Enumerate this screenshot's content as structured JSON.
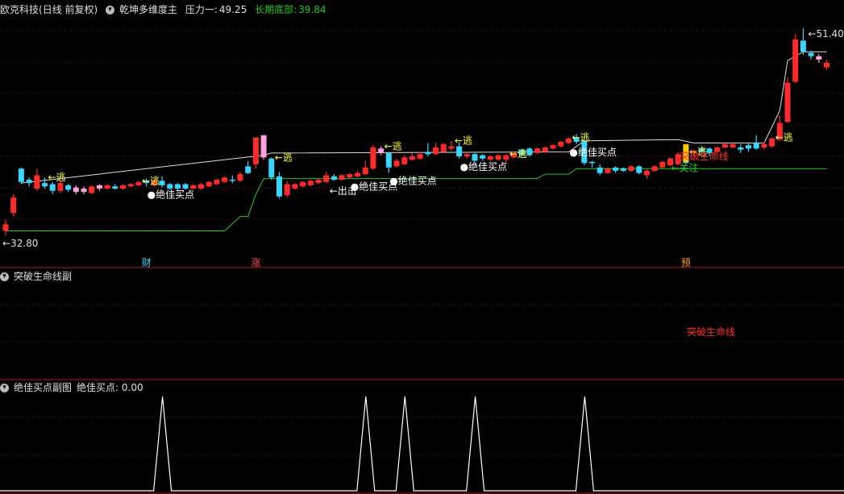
{
  "main": {
    "stock": "欧克科技",
    "period": "(日线 前复权)",
    "indicator": "乾坤多维度主",
    "pressure_label": "压力一:",
    "pressure_value": "49.25",
    "bottom_label": "长期底部:",
    "bottom_value": "39.84",
    "high_label": "51.40",
    "low_label": "32.80",
    "colors": {
      "up": "#ff2a2a",
      "down": "#38d5ff",
      "special": "#ffa0e0",
      "pressure": "#dddddd",
      "bottom": "#22cc22"
    }
  },
  "sub1": {
    "title": "突破生命线副",
    "label": "突破生命线"
  },
  "sub2": {
    "title": "绝佳买点副图",
    "value_label": "绝佳买点: 0.00"
  },
  "chart_data": {
    "type": "candlestick",
    "x_range": [
      0,
      105
    ],
    "y_range": [
      31.5,
      52.5
    ],
    "candles": [
      [
        0,
        33.2,
        33.8,
        32.8,
        34.2,
        "up"
      ],
      [
        1,
        34.8,
        36.2,
        34.5,
        36.5,
        "up"
      ],
      [
        2,
        38.8,
        37.6,
        37.4,
        38.9,
        "down"
      ],
      [
        3,
        37.8,
        37.5,
        37.2,
        38.0,
        "down"
      ],
      [
        4,
        37.0,
        38.2,
        36.8,
        38.8,
        "up"
      ],
      [
        5,
        37.5,
        37.2,
        37.0,
        38.0,
        "down"
      ],
      [
        6,
        37.4,
        36.8,
        36.5,
        37.6,
        "down"
      ],
      [
        7,
        36.8,
        37.5,
        36.6,
        37.7,
        "up"
      ],
      [
        8,
        37.3,
        36.9,
        36.7,
        37.4,
        "down"
      ],
      [
        9,
        37.1,
        36.7,
        36.5,
        37.3,
        "special"
      ],
      [
        10,
        37.0,
        36.7,
        36.5,
        37.2,
        "special"
      ],
      [
        11,
        36.6,
        37.2,
        36.5,
        37.3,
        "up"
      ],
      [
        12,
        37.0,
        37.3,
        36.8,
        37.4,
        "special"
      ],
      [
        13,
        37.0,
        37.3,
        36.9,
        37.4,
        "up"
      ],
      [
        14,
        37.2,
        37.0,
        36.9,
        37.4,
        "down"
      ],
      [
        15,
        37.0,
        37.3,
        36.9,
        37.4,
        "up"
      ],
      [
        16,
        37.2,
        37.4,
        37.1,
        37.5,
        "up"
      ],
      [
        17,
        37.3,
        37.6,
        37.2,
        37.7,
        "up"
      ],
      [
        18,
        37.7,
        37.5,
        37.2,
        37.9,
        "down"
      ],
      [
        19,
        37.3,
        37.7,
        37.2,
        37.8,
        "up"
      ],
      [
        20,
        37.7,
        37.3,
        37.1,
        38.1,
        "down"
      ],
      [
        21,
        37.4,
        37.0,
        36.9,
        37.5,
        "down"
      ],
      [
        22,
        37.4,
        37.0,
        36.8,
        37.5,
        "down"
      ],
      [
        23,
        37.4,
        37.0,
        36.9,
        37.5,
        "down"
      ],
      [
        24,
        37.0,
        37.3,
        36.9,
        37.4,
        "up"
      ],
      [
        25,
        37.0,
        37.4,
        36.9,
        37.5,
        "up"
      ],
      [
        26,
        37.2,
        37.6,
        37.1,
        37.7,
        "up"
      ],
      [
        27,
        37.4,
        37.8,
        37.3,
        37.9,
        "up"
      ],
      [
        28,
        37.6,
        38.0,
        37.5,
        38.1,
        "up"
      ],
      [
        29,
        37.8,
        37.7,
        37.5,
        38.2,
        "down"
      ],
      [
        30,
        37.7,
        38.3,
        37.6,
        38.5,
        "up"
      ],
      [
        31,
        38.4,
        39.0,
        38.3,
        39.5,
        "down"
      ],
      [
        32,
        39.2,
        41.6,
        38.8,
        41.6,
        "up"
      ],
      [
        33,
        39.8,
        41.8,
        39.6,
        41.8,
        "special"
      ],
      [
        34,
        39.7,
        38.0,
        37.8,
        39.8,
        "down"
      ],
      [
        35,
        38.1,
        36.3,
        36.1,
        38.5,
        "down"
      ],
      [
        36,
        36.4,
        37.4,
        36.2,
        37.7,
        "up"
      ],
      [
        37,
        37.0,
        37.4,
        36.9,
        37.5,
        "up"
      ],
      [
        38,
        37.2,
        37.6,
        37.1,
        37.7,
        "up"
      ],
      [
        39,
        37.3,
        37.7,
        37.2,
        37.8,
        "up"
      ],
      [
        40,
        37.5,
        37.8,
        37.4,
        37.9,
        "up"
      ],
      [
        41,
        37.6,
        38.2,
        37.5,
        38.5,
        "up"
      ],
      [
        42,
        38.1,
        37.8,
        37.7,
        38.3,
        "down"
      ],
      [
        43,
        37.8,
        38.2,
        37.7,
        38.3,
        "up"
      ],
      [
        44,
        38.0,
        38.3,
        37.9,
        38.4,
        "up"
      ],
      [
        45,
        38.1,
        38.4,
        38.0,
        38.6,
        "up"
      ],
      [
        46,
        38.3,
        38.9,
        38.2,
        39.5,
        "up"
      ],
      [
        47,
        38.8,
        40.7,
        38.7,
        40.9,
        "up"
      ],
      [
        48,
        40.6,
        40.2,
        40.0,
        40.8,
        "special"
      ],
      [
        49,
        40.2,
        38.9,
        38.4,
        40.3,
        "down"
      ],
      [
        50,
        39.0,
        39.5,
        38.9,
        39.7,
        "up"
      ],
      [
        51,
        39.2,
        39.8,
        39.1,
        40.0,
        "up"
      ],
      [
        52,
        39.6,
        39.9,
        39.5,
        40.2,
        "up"
      ],
      [
        53,
        39.7,
        40.1,
        39.6,
        40.3,
        "up"
      ],
      [
        54,
        40.3,
        40.1,
        39.9,
        41.1,
        "down"
      ],
      [
        55,
        40.1,
        40.7,
        40.0,
        41.1,
        "up"
      ],
      [
        56,
        40.3,
        41.0,
        40.2,
        41.1,
        "up"
      ],
      [
        57,
        40.8,
        40.6,
        40.4,
        41.3,
        "up"
      ],
      [
        58,
        40.8,
        39.9,
        39.7,
        41.2,
        "down"
      ],
      [
        59,
        40.1,
        39.9,
        39.7,
        40.3,
        "up"
      ],
      [
        60,
        40.1,
        39.5,
        39.4,
        40.2,
        "down"
      ],
      [
        61,
        40.0,
        39.7,
        39.5,
        40.1,
        "down"
      ],
      [
        62,
        39.6,
        39.9,
        39.5,
        40.0,
        "up"
      ],
      [
        63,
        39.6,
        40.0,
        39.5,
        40.1,
        "up"
      ],
      [
        64,
        40.0,
        39.6,
        39.2,
        40.1,
        "up"
      ],
      [
        65,
        39.8,
        40.2,
        39.7,
        40.3,
        "up"
      ],
      [
        66,
        40.0,
        40.5,
        39.9,
        40.6,
        "down"
      ],
      [
        67,
        40.6,
        40.0,
        39.9,
        40.7,
        "down"
      ],
      [
        68,
        40.2,
        40.6,
        40.1,
        40.7,
        "up"
      ],
      [
        69,
        40.3,
        40.7,
        40.2,
        40.8,
        "up"
      ],
      [
        70,
        40.6,
        40.9,
        40.5,
        41.0,
        "up"
      ],
      [
        71,
        40.8,
        41.2,
        40.7,
        41.3,
        "up"
      ],
      [
        72,
        41.1,
        41.5,
        41.0,
        41.6,
        "up"
      ],
      [
        73,
        41.6,
        41.2,
        41.0,
        41.9,
        "down"
      ],
      [
        74,
        41.3,
        39.3,
        39.1,
        41.4,
        "down"
      ],
      [
        75,
        39.4,
        39.3,
        38.9,
        39.5,
        "down"
      ],
      [
        76,
        38.9,
        38.4,
        38.2,
        39.2,
        "down"
      ],
      [
        77,
        38.4,
        38.8,
        38.3,
        38.9,
        "up"
      ],
      [
        78,
        38.6,
        38.9,
        38.4,
        39.0,
        "down"
      ],
      [
        79,
        38.8,
        38.6,
        38.5,
        38.9,
        "down"
      ],
      [
        80,
        38.6,
        39.0,
        38.5,
        39.1,
        "up"
      ],
      [
        81,
        39.0,
        38.4,
        38.3,
        39.1,
        "down"
      ],
      [
        82,
        38.2,
        38.6,
        37.9,
        38.8,
        "up"
      ],
      [
        83,
        38.6,
        39.0,
        38.5,
        39.1,
        "up"
      ],
      [
        84,
        38.9,
        39.4,
        38.8,
        39.5,
        "up"
      ],
      [
        85,
        39.1,
        39.7,
        39.0,
        39.8,
        "up"
      ],
      [
        86,
        39.2,
        40.1,
        39.1,
        40.3,
        "up"
      ],
      [
        87,
        39.3,
        40.1,
        39.2,
        40.3,
        "down"
      ],
      [
        88,
        40.2,
        40.4,
        40.0,
        40.5,
        "up"
      ],
      [
        89,
        40.6,
        40.3,
        40.1,
        40.8,
        "down"
      ],
      [
        90,
        40.6,
        40.2,
        39.9,
        40.7,
        "down"
      ],
      [
        91,
        40.3,
        40.7,
        40.2,
        40.8,
        "up"
      ],
      [
        92,
        40.7,
        41.0,
        40.6,
        41.1,
        "up"
      ],
      [
        93,
        41.0,
        40.7,
        40.6,
        41.1,
        "up"
      ],
      [
        94,
        40.7,
        40.5,
        40.2,
        41.0,
        "down"
      ],
      [
        95,
        40.9,
        40.6,
        40.3,
        41.1,
        "down"
      ],
      [
        96,
        40.6,
        41.1,
        40.5,
        41.8,
        "down"
      ],
      [
        97,
        41.0,
        40.7,
        40.5,
        41.2,
        "up"
      ],
      [
        98,
        40.8,
        41.5,
        40.7,
        41.6,
        "up"
      ],
      [
        99,
        41.4,
        42.9,
        41.3,
        43.6,
        "up"
      ],
      [
        100,
        43.0,
        46.5,
        42.9,
        47.0,
        "up"
      ],
      [
        101,
        46.6,
        50.4,
        46.5,
        50.9,
        "up"
      ],
      [
        102,
        50.3,
        49.3,
        49.0,
        51.4,
        "down"
      ],
      [
        103,
        49.2,
        48.9,
        48.6,
        49.4,
        "down"
      ],
      [
        104,
        48.6,
        48.9,
        48.3,
        49.1,
        "special"
      ],
      [
        105,
        48.3,
        47.9,
        47.7,
        48.6,
        "up"
      ]
    ],
    "pressure_line": [
      [
        2,
        37.5
      ],
      [
        33,
        40.0
      ],
      [
        34,
        40.2
      ],
      [
        72,
        40.3
      ],
      [
        74,
        41.3
      ],
      [
        86,
        41.4
      ],
      [
        88,
        41.1
      ],
      [
        97,
        41.1
      ],
      [
        99,
        44.0
      ],
      [
        100,
        48.5
      ],
      [
        102,
        49.3
      ],
      [
        105,
        49.3
      ]
    ],
    "bottom_line": [
      [
        0,
        33.2
      ],
      [
        28,
        33.2
      ],
      [
        30,
        34.5
      ],
      [
        31,
        34.5
      ],
      [
        32,
        36.5
      ],
      [
        33,
        37.9
      ],
      [
        36,
        37.9
      ],
      [
        60,
        37.9
      ],
      [
        68,
        37.9
      ],
      [
        69,
        38.3
      ],
      [
        72,
        38.3
      ],
      [
        73,
        38.8
      ],
      [
        105,
        38.8
      ]
    ],
    "markers": {
      "escape": [
        5,
        17,
        34,
        48,
        57,
        64,
        72,
        87,
        98
      ],
      "buy": [
        18,
        44,
        49,
        58,
        72
      ],
      "out": [
        41
      ],
      "attention": [
        85
      ],
      "breakthrough": [
        84
      ],
      "buy_text": "绝佳买点",
      "escape_text": "逃",
      "out_text": "出击",
      "attention_text": "关注",
      "breakthrough_text": "突破生命线"
    },
    "events": [
      {
        "x": 18,
        "text": "财",
        "color": "#38d5ff"
      },
      {
        "x": 32,
        "text": "涨",
        "color": "#ff4d4d"
      },
      {
        "x": 87,
        "text": "预",
        "color": "#ffa030"
      }
    ],
    "sub_signals": [
      18,
      44,
      49,
      58,
      72
    ]
  }
}
